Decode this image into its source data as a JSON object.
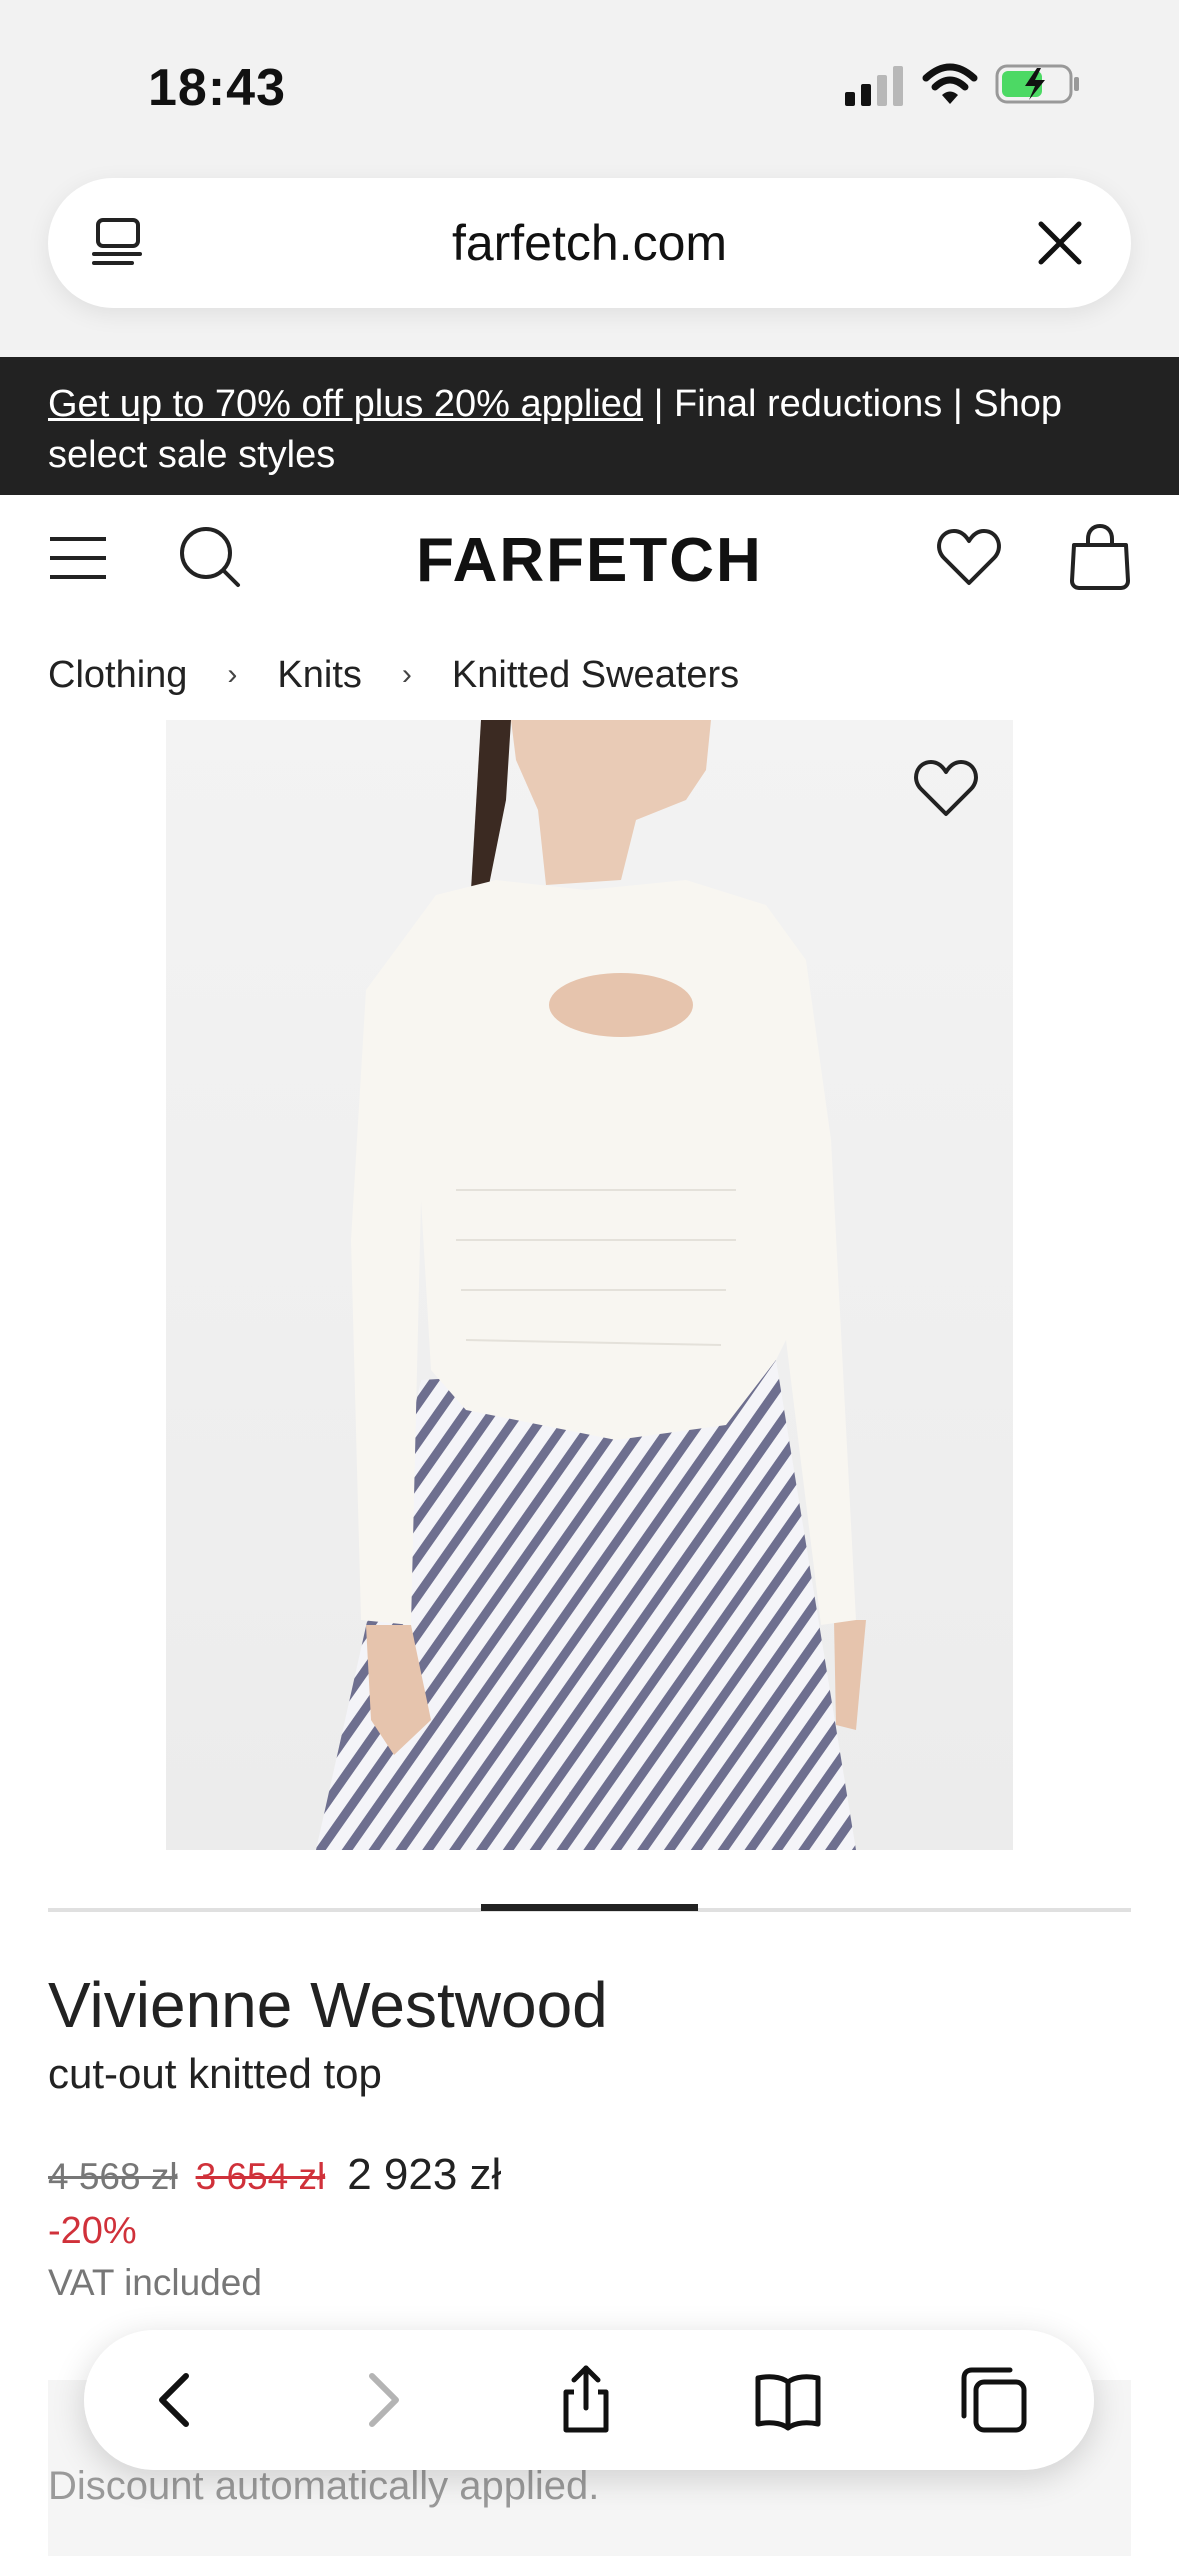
{
  "status_bar": {
    "time": "18:43"
  },
  "browser": {
    "url": "farfetch.com"
  },
  "promo": {
    "link_text": "Get up to 70% off plus 20% applied",
    "rest_text": " | Final reductions | Shop select sale styles"
  },
  "header": {
    "logo": "FARFETCH"
  },
  "breadcrumb": {
    "items": [
      "Clothing",
      "Knits",
      "Knitted Sweaters"
    ],
    "separator": "›"
  },
  "carousel": {
    "active_index": 3,
    "total": 5
  },
  "product": {
    "brand": "Vivienne Westwood",
    "name": "cut-out knitted top",
    "price_original": "4 568 zł",
    "price_previous": "3 654 zł",
    "price_final": "2 923 zł",
    "discount": "-20%",
    "vat_note": "VAT included"
  },
  "discount_box": {
    "text": "Discount automatically applied."
  },
  "colors": {
    "sale_red": "#d0313a",
    "banner_bg": "#222222",
    "muted_gray": "#777777"
  }
}
